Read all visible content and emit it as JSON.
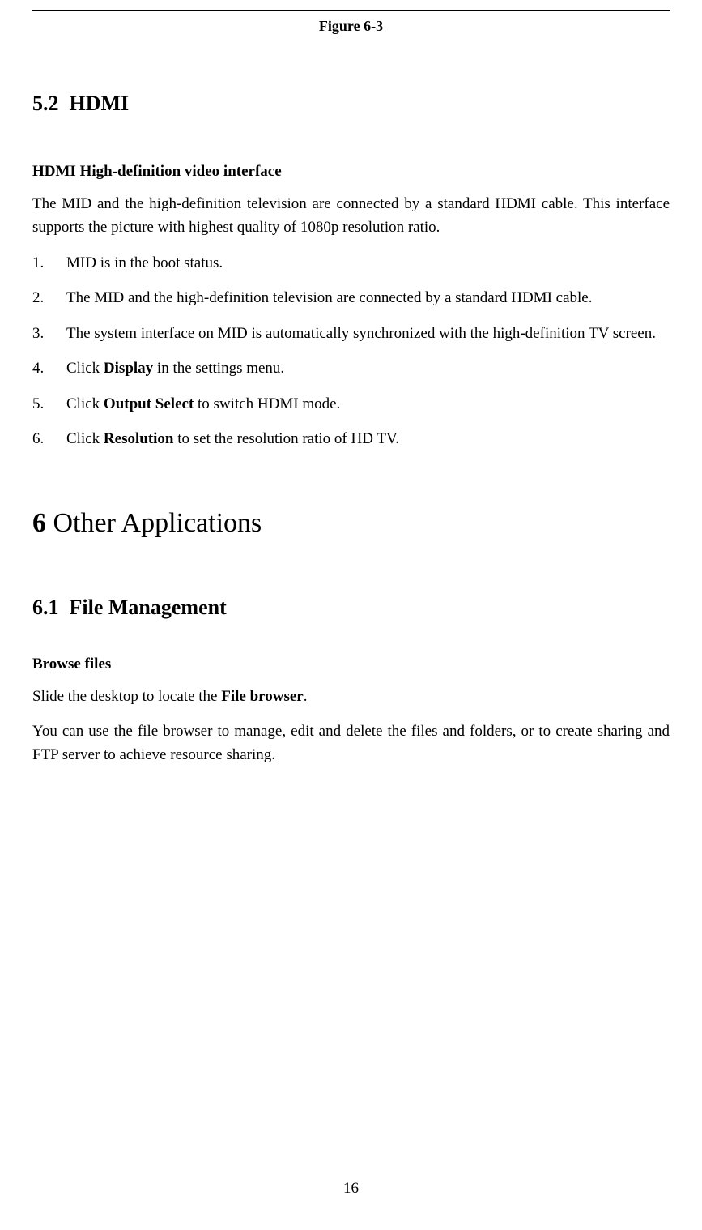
{
  "figureCaption": "Figure 6-3",
  "section52": {
    "number": "5.2",
    "title": "HDMI",
    "subheading": "HDMI High-definition video interface",
    "intro": "The MID and the high-definition television are connected by a standard HDMI cable. This interface supports the picture with highest quality of 1080p resolution ratio.",
    "items": [
      {
        "num": "1.",
        "text": "MID is in the boot status."
      },
      {
        "num": "2.",
        "text": "The MID and the high-definition television are connected by a standard HDMI cable."
      },
      {
        "num": "3.",
        "text": "The system interface on MID is automatically synchronized with the high-definition TV screen."
      },
      {
        "num": "4.",
        "prefix": "Click ",
        "bold": "Display",
        "suffix": " in the settings menu."
      },
      {
        "num": "5.",
        "prefix": "Click ",
        "bold": "Output Select",
        "suffix": " to switch HDMI mode."
      },
      {
        "num": "6.",
        "prefix": "Click ",
        "bold": "Resolution",
        "suffix": " to set the resolution ratio of HD TV."
      }
    ]
  },
  "chapter6": {
    "number": "6",
    "title": "Other Applications"
  },
  "section61": {
    "number": "6.1",
    "title": "File Management",
    "subheading": "Browse files",
    "para1_prefix": "Slide the desktop to locate the ",
    "para1_bold": "File browser",
    "para1_suffix": ".",
    "para2": "You can use the file browser to manage, edit and delete the files and folders, or to create sharing and FTP server to achieve resource sharing."
  },
  "pageNumber": "16"
}
